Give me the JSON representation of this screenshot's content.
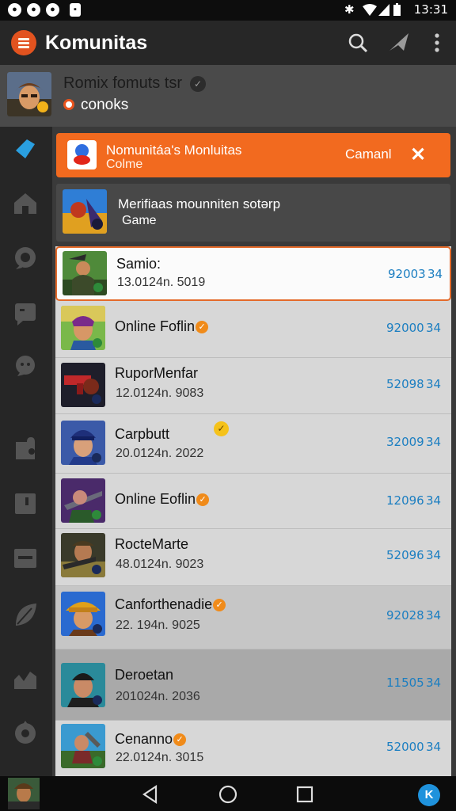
{
  "status_bar": {
    "time": "13:31",
    "left_icons": [
      "notification-icon",
      "notification-icon",
      "notification-icon",
      "notification-icon"
    ],
    "right_icons": [
      "bluetooth-icon",
      "wifi-icon",
      "signal-icon",
      "battery-icon"
    ]
  },
  "app_bar": {
    "title": "Komunitas",
    "actions": [
      "search-icon",
      "send-icon",
      "more-vertical-icon"
    ]
  },
  "profile": {
    "name": "Romix fomuts tsr",
    "subtitle": "conoks"
  },
  "rail": {
    "items": [
      "pin-icon",
      "home-icon",
      "chat-icon",
      "message-icon",
      "discussion-icon",
      "puzzle-icon",
      "flag-icon",
      "inbox-icon",
      "leaf-icon",
      "chart-icon",
      "settings-icon"
    ]
  },
  "banner": {
    "title": "Nomunitáa's Monluitas",
    "subtitle": "Colme",
    "action": "Camanl",
    "close": "✕"
  },
  "feature": {
    "title": "Merifiaas mounniten sotərp",
    "subtitle": "Game"
  },
  "games": [
    {
      "title": "Samio:",
      "date": "13.0124n. 5019",
      "count": "92003",
      "count2": "34"
    },
    {
      "title": "Online Foflin",
      "badge": "✓",
      "date": "",
      "count": "92000",
      "count2": "34"
    },
    {
      "title": "RuporMenfar",
      "date": "12.0124n. 9083",
      "count": "52098",
      "count2": "34"
    },
    {
      "title": "Carpbutt",
      "badge": "✓",
      "date": "20.0124n. 2022",
      "count": "32009",
      "count2": "34"
    },
    {
      "title": "Online Eoflin",
      "badge": "✓",
      "date": "",
      "count": "12096",
      "count2": "34"
    },
    {
      "title": "RocteMarte",
      "date": "48.0124n. 9023",
      "count": "52096",
      "count2": "34"
    },
    {
      "title": "Canforthenadie",
      "badge": "✓",
      "date": "22. 194n. 9025",
      "count": "92028",
      "count2": "34"
    },
    {
      "title": "Deroetan",
      "date": "201024n. 2036",
      "count": "11505",
      "count2": "34"
    },
    {
      "title": "Cenanno",
      "badge": "✓",
      "date": "22.0124n. 3015",
      "count": "52000",
      "count2": "34"
    }
  ],
  "nav_bar": {
    "buttons": [
      "back-icon",
      "home-icon",
      "recents-icon"
    ],
    "fab_label": "K"
  },
  "colors": {
    "accent": "#f26a1f",
    "count": "#1b7ec1",
    "app_bar": "#272727"
  }
}
